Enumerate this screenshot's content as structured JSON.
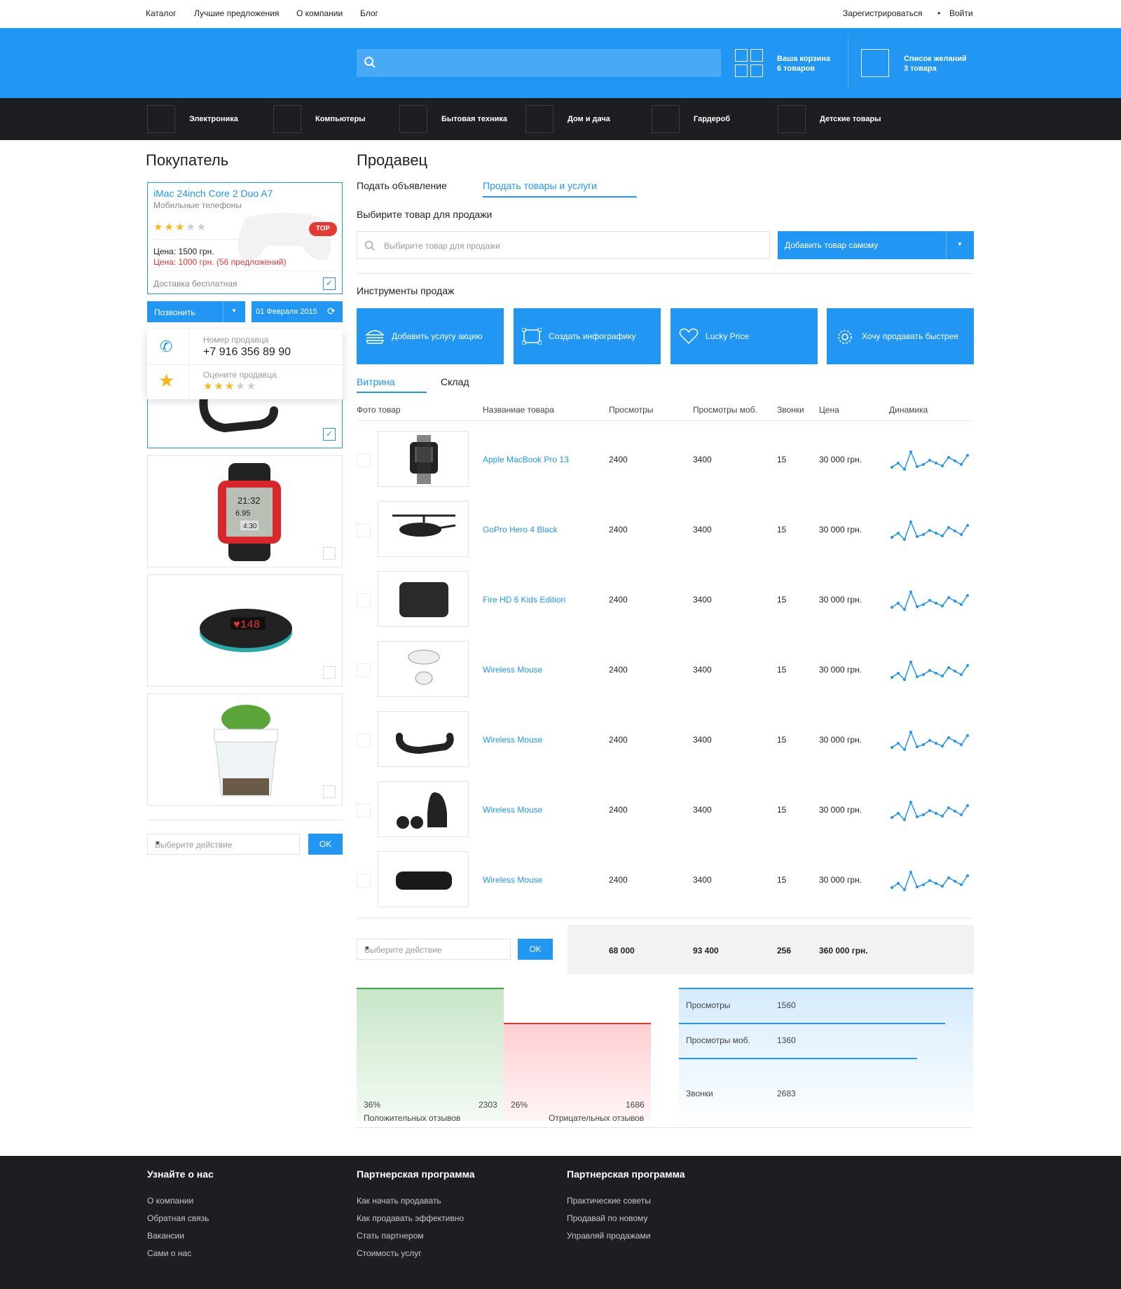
{
  "topnav": {
    "links": [
      "Каталог",
      "Лучшие предложения",
      "О компании",
      "Блог"
    ],
    "register": "Зарегистрироваться",
    "login": "Войти"
  },
  "header": {
    "cart_title": "Ваша корзина",
    "cart_count": "6 товаров",
    "wish_title": "Список желаний",
    "wish_count": "3 товара"
  },
  "categories": [
    "Электроника",
    "Компьютеры",
    "Бытовая техника",
    "Дом и дача",
    "Гардероб",
    "Детские товары"
  ],
  "buyer": {
    "title": "Покупатель",
    "card": {
      "name": "iMac 24inch Core 2 Duo A7",
      "category": "Мобильные телефоны",
      "rating": 3,
      "badge": "TOP",
      "price": "Цена: 1500 грн.",
      "sale": "Цена: 1000 грн. (56 предложений)",
      "delivery": "Доставка бесплатная"
    },
    "call_label": "Позвонить",
    "date_label": "01 Февраля 2015",
    "phone_caption": "Номер продавца",
    "phone": "+7 916 356 89 90",
    "rate_caption": "Оцените продавца",
    "seller_rating": 3,
    "action_placeholder": "Выберите действие",
    "ok": "OK"
  },
  "seller": {
    "title": "Продавец",
    "tabs": [
      "Подать объявление",
      "Продать товары и услуги"
    ],
    "choose_label": "Выбирите товар для продажи",
    "search_placeholder": "Выбирите товар для продажи",
    "add_button": "Добавить товар самому",
    "tools_label": "Инструменты продаж",
    "tools": [
      "Добавить услугу акцию",
      "Создать инфографику",
      "Lucky Price",
      "Хочу продавать быстрее"
    ],
    "subtabs": [
      "Витрина",
      "Склад"
    ],
    "columns": [
      "Фото товар",
      "Названиае товара",
      "Просмотры",
      "Просмотры моб.",
      "Звонки",
      "Цена",
      "Динамика"
    ],
    "rows": [
      {
        "name": "Apple MacBook Pro 13",
        "views": "2400",
        "mobile": "3400",
        "calls": "15",
        "price": "30 000 грн."
      },
      {
        "name": "GoPro Hero 4 Black",
        "views": "2400",
        "mobile": "3400",
        "calls": "15",
        "price": "30 000 грн."
      },
      {
        "name": "Fire HD 6 Kids Edition",
        "views": "2400",
        "mobile": "3400",
        "calls": "15",
        "price": "30 000 грн."
      },
      {
        "name": "Wireless Mouse",
        "views": "2400",
        "mobile": "3400",
        "calls": "15",
        "price": "30 000 грн."
      },
      {
        "name": "Wireless Mouse",
        "views": "2400",
        "mobile": "3400",
        "calls": "15",
        "price": "30 000 грн."
      },
      {
        "name": "Wireless Mouse",
        "views": "2400",
        "mobile": "3400",
        "calls": "15",
        "price": "30 000 грн."
      },
      {
        "name": "Wireless Mouse",
        "views": "2400",
        "mobile": "3400",
        "calls": "15",
        "price": "30 000 грн."
      }
    ],
    "action_placeholder": "Выберите действие",
    "ok": "OK",
    "totals": {
      "views": "68 000",
      "mobile": "93 400",
      "calls": "256",
      "price": "360 000 грн."
    }
  },
  "stats": {
    "positive_pct": "36%",
    "positive_count": "2303",
    "positive_label": "Положительных отзывов",
    "negative_pct": "26%",
    "negative_count": "1686",
    "negative_label": "Отрицательных отзывов",
    "metrics": [
      {
        "label": "Просмотры",
        "value": "1560"
      },
      {
        "label": "Просмотры моб.",
        "value": "1360"
      },
      {
        "label": "Звонки",
        "value": "2683"
      }
    ]
  },
  "footer": {
    "cols": [
      {
        "title": "Узнайте о нас",
        "links": [
          "О компании",
          "Обратная связь",
          "Вакансии",
          "Сами о нас"
        ]
      },
      {
        "title": "Партнерская программа",
        "links": [
          "Как начать продавать",
          "Как продавать эффективно",
          "Стать партнером",
          "Стоимость услуг"
        ]
      },
      {
        "title": "Партнерская программа",
        "links": [
          "Практические советы",
          "Продавай по новому",
          "Управляй продажами"
        ]
      }
    ]
  },
  "colors": {
    "accent": "#2196f3",
    "dark": "#1d1e22",
    "top_badge": "#e53935",
    "star": "#f5b71a"
  }
}
